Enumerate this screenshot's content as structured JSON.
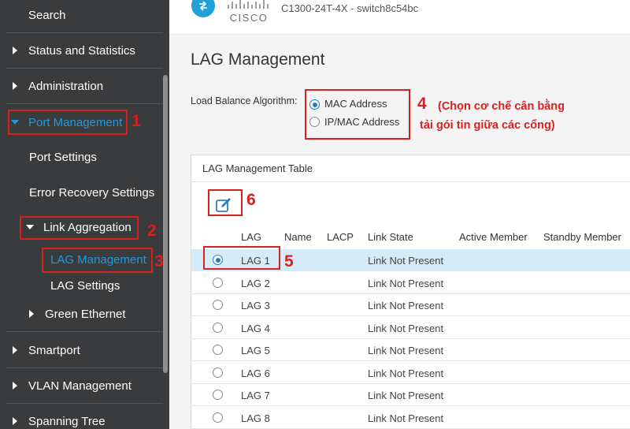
{
  "sidebar": {
    "search": "Search",
    "status": "Status and Statistics",
    "admin": "Administration",
    "port_mgmt": "Port Management",
    "port_settings": "Port Settings",
    "error_recovery": "Error Recovery Settings",
    "link_agg": "Link Aggregation",
    "lag_mgmt": "LAG Management",
    "lag_settings": "LAG Settings",
    "green_eth": "Green Ethernet",
    "smartport": "Smartport",
    "vlan": "VLAN Management",
    "spanning": "Spanning Tree"
  },
  "header": {
    "brand": "CISCO",
    "device": "C1300-24T-4X - switch8c54bc"
  },
  "page": {
    "title": "LAG Management",
    "lb_label": "Load Balance Algorithm:",
    "mac_option": "MAC Address",
    "ipmac_option": "IP/MAC Address"
  },
  "table": {
    "title": "LAG Management Table",
    "headers": [
      "LAG",
      "Name",
      "LACP",
      "Link State",
      "Active Member",
      "Standby Member"
    ],
    "rows": [
      {
        "lag": "LAG 1",
        "link_state": "Link Not Present"
      },
      {
        "lag": "LAG 2",
        "link_state": "Link Not Present"
      },
      {
        "lag": "LAG 3",
        "link_state": "Link Not Present"
      },
      {
        "lag": "LAG 4",
        "link_state": "Link Not Present"
      },
      {
        "lag": "LAG 5",
        "link_state": "Link Not Present"
      },
      {
        "lag": "LAG 6",
        "link_state": "Link Not Present"
      },
      {
        "lag": "LAG 7",
        "link_state": "Link Not Present"
      },
      {
        "lag": "LAG 8",
        "link_state": "Link Not Present"
      }
    ]
  },
  "annotations": {
    "n1": "1",
    "n2": "2",
    "n3": "3",
    "n4": "4",
    "n5": "5",
    "n6": "6",
    "note_line1": "(Chọn cơ chế cân bằng",
    "note_line2": "tải gói tin giữa các cổng)"
  },
  "colors": {
    "sidebar_bg": "#3a3b3d",
    "accent": "#1f9ae0",
    "annotation": "#d82020",
    "selected_row": "#d5ebf8"
  },
  "icons": {
    "brand": "cisco-circle-icon",
    "edit": "edit-icon"
  }
}
